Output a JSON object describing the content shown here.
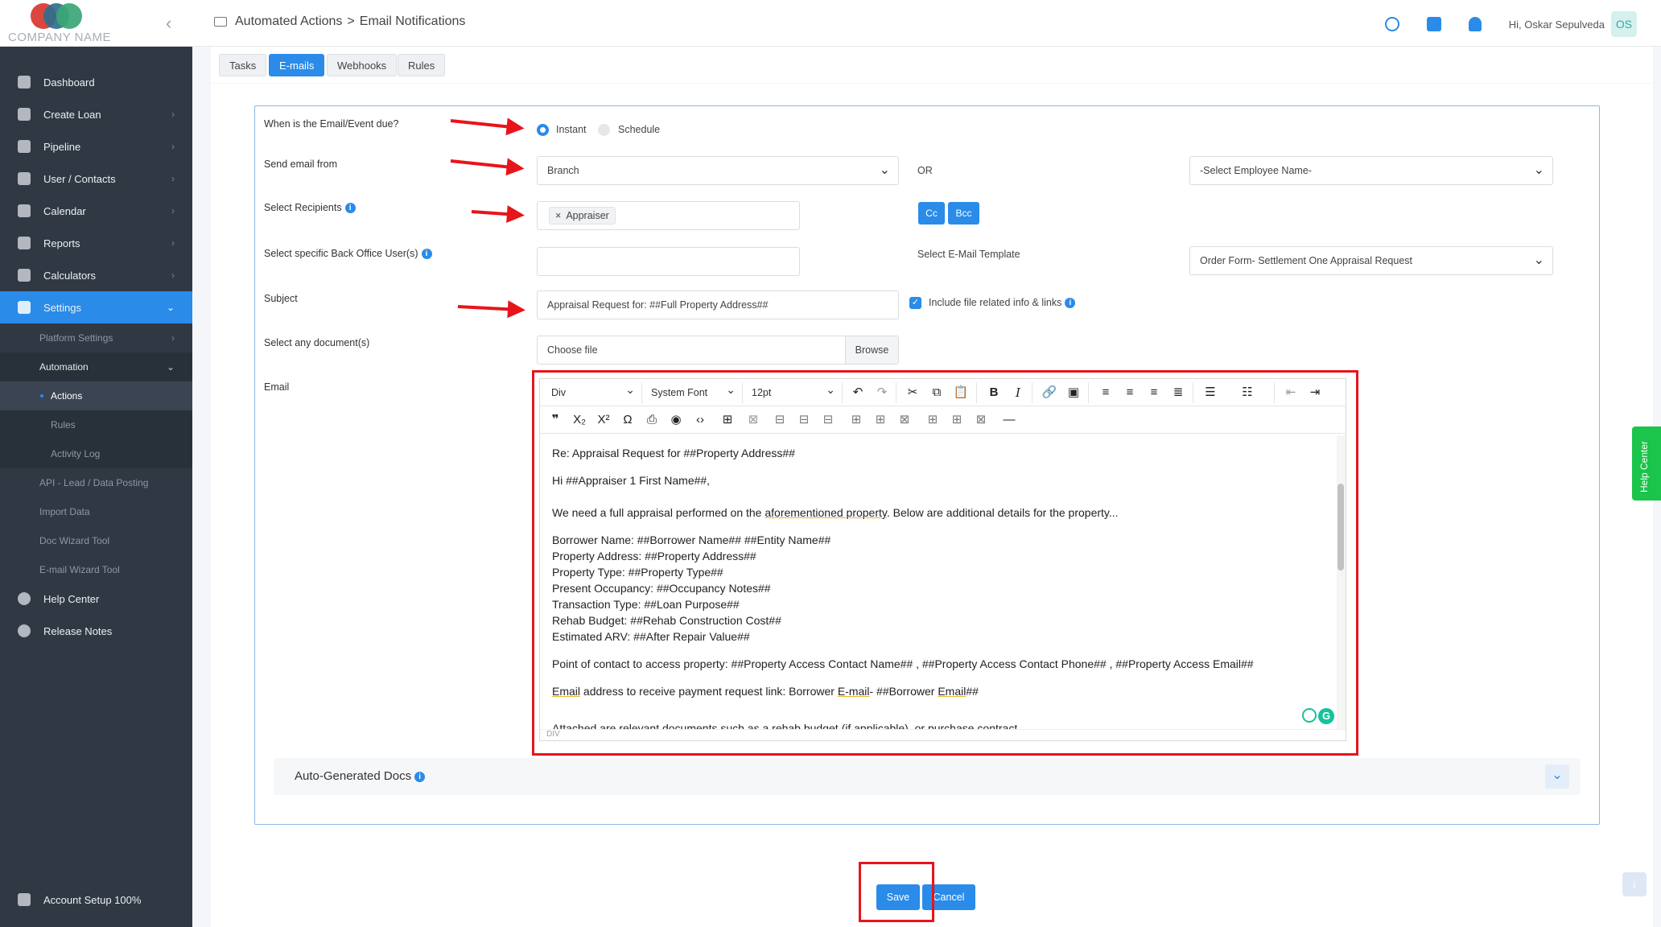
{
  "brand": {
    "company": "COMPANY NAME"
  },
  "breadcrumb": {
    "section": "Automated Actions",
    "separator": ">",
    "page": "Email Notifications"
  },
  "user": {
    "greeting": "Hi, Oskar Sepulveda",
    "initials": "OS"
  },
  "sidebar": {
    "items": [
      {
        "label": "Dashboard",
        "icon": "home-icon"
      },
      {
        "label": "Create Loan",
        "icon": "document-icon"
      },
      {
        "label": "Pipeline",
        "icon": "list-icon"
      },
      {
        "label": "User / Contacts",
        "icon": "users-icon"
      },
      {
        "label": "Calendar",
        "icon": "calendar-icon"
      },
      {
        "label": "Reports",
        "icon": "chart-icon"
      },
      {
        "label": "Calculators",
        "icon": "calculator-icon"
      },
      {
        "label": "Settings",
        "icon": "wrench-icon"
      }
    ],
    "settings_sub": [
      "Platform Settings",
      "Automation"
    ],
    "automation_sub": [
      "Actions",
      "Rules",
      "Activity Log"
    ],
    "more_sub": [
      "API - Lead / Data Posting",
      "Import Data",
      "Doc Wizard Tool",
      "E-mail Wizard Tool"
    ],
    "bottom_items": [
      {
        "label": "Help Center",
        "icon": "help-icon"
      },
      {
        "label": "Release Notes",
        "icon": "info-icon"
      }
    ],
    "account_setup": "Account Setup 100%"
  },
  "tabs": [
    "Tasks",
    "E-mails",
    "Webhooks",
    "Rules"
  ],
  "form": {
    "due_label": "When is the Email/Event due?",
    "due_options": [
      "Instant",
      "Schedule"
    ],
    "send_from_label": "Send email from",
    "send_from_value": "Branch",
    "or_label": "OR",
    "employee_placeholder": "-Select Employee Name-",
    "recipients_label": "Select Recipients",
    "recipient_tag": "Appraiser",
    "cc_label": "Cc",
    "bcc_label": "Bcc",
    "back_office_label": "Select specific Back Office User(s)",
    "template_label": "Select E-Mail Template",
    "template_value": "Order Form- Settlement One Appraisal Request",
    "subject_label": "Subject",
    "subject_value": "Appraisal Request for: ##Full Property Address##",
    "include_label": "Include file related info & links",
    "documents_label": "Select any document(s)",
    "file_placeholder": "Choose file",
    "browse_label": "Browse",
    "email_label": "Email"
  },
  "editor": {
    "block_format": "Div",
    "font_family": "System Font",
    "font_size": "12pt",
    "status_path": "DIV",
    "lines": [
      "Re: Appraisal Request for ##Property Address##",
      "Hi ##Appraiser 1 First Name##,",
      "We need a full appraisal performed on the",
      "aforementioned property",
      ". Below are additional details for the property...",
      "Borrower Name: ##Borrower Name##  ##Entity Name##",
      "Property Address: ##Property Address##",
      "Property Type: ##Property Type##",
      "Present Occupancy: ##Occupancy Notes##",
      "Transaction Type: ##Loan Purpose##",
      "Rehab Budget: ##Rehab Construction Cost##",
      "Estimated ARV: ##After Repair Value##",
      "Point of contact to access property: ##Property Access Contact Name## , ##Property Access Contact Phone## , ##Property Access Email##",
      "Email",
      " address to receive payment request link: Borrower ",
      "E-mail",
      "- ##Borrower ",
      "Email",
      "##",
      "Attached are relevant documents such as a rehab budget (if applicable), or purchase contract."
    ]
  },
  "accordion": {
    "title": "Auto-Generated Docs"
  },
  "actions": {
    "save": "Save",
    "cancel": "Cancel"
  },
  "help_tab": "Help Center",
  "colors": {
    "primary": "#2a8be8",
    "sidebar": "#303844",
    "highlight": "#e8141b",
    "help": "#1bc44a"
  }
}
